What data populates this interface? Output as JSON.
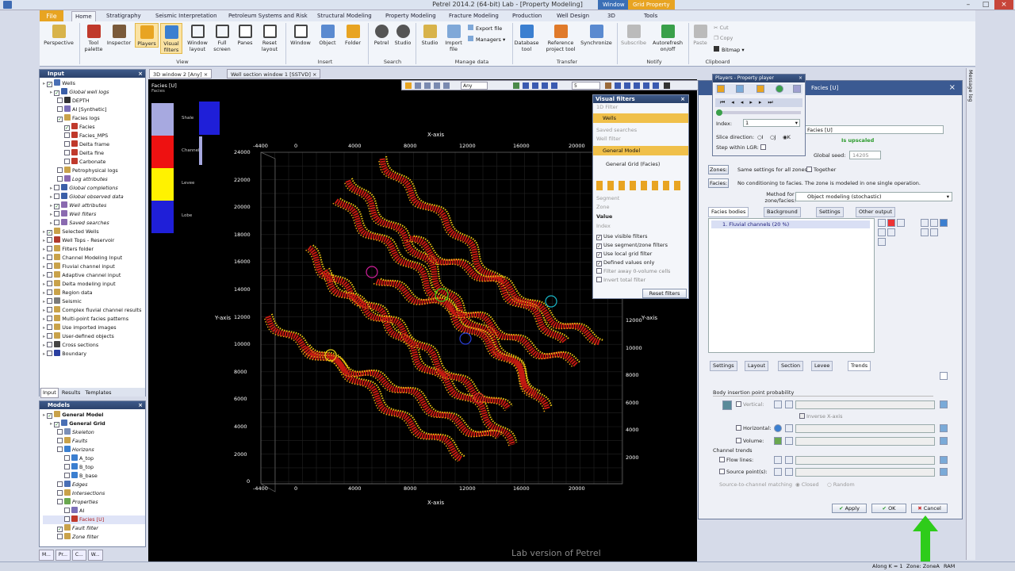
{
  "window": {
    "title": "Petrel 2014.2 (64-bit) Lab - [Property Modeling]",
    "context_tabs": [
      "Window",
      "Grid Property"
    ]
  },
  "ribbon": {
    "file_tab": "File",
    "tabs": [
      "Home",
      "Stratigraphy",
      "Seismic Interpretation",
      "Petroleum Systems and Risk",
      "Structural Modeling",
      "Property Modeling",
      "Fracture Modeling",
      "Production",
      "Well Design",
      "3D",
      "Tools"
    ],
    "buttons": {
      "perspective": "Perspective",
      "tool_palette": "Tool palette",
      "inspector": "Inspector",
      "players": "Players",
      "visual_filters": "Visual filters",
      "window_layout": "Window layout",
      "full_screen": "Full screen",
      "panes": "Panes",
      "reset_layout": "Reset layout",
      "window": "Window",
      "object": "Object",
      "folder": "Folder",
      "petrel": "Petrel",
      "studio": "Studio",
      "studio2": "Studio",
      "import_file": "Import file",
      "export_file": "Export file",
      "managers": "Managers",
      "database_tool": "Database tool",
      "reference_project_tool": "Reference project tool",
      "synchronize": "Synchronize",
      "subscribe": "Subscribe",
      "autorefresh": "Autorefresh on/off",
      "paste": "Paste",
      "cut": "Cut",
      "copy": "Copy",
      "bitmap": "Bitmap"
    },
    "groups": {
      "view": "View",
      "insert": "Insert",
      "search": "Search",
      "manage_data": "Manage data",
      "transfer": "Transfer",
      "notify": "Notify",
      "clipboard": "Clipboard"
    }
  },
  "input_panel": {
    "title": "Input",
    "items": [
      {
        "label": "Wells",
        "lvl": 0,
        "icon": "#4a6fb5",
        "cb": true
      },
      {
        "label": "Global well logs",
        "lvl": 1,
        "icon": "#3b5fa8",
        "cb": true,
        "it": true
      },
      {
        "label": "DEPTH",
        "lvl": 2,
        "icon": "#333",
        "cb": false
      },
      {
        "label": "AI [Synthetic]",
        "lvl": 2,
        "icon": "#7b6fb8",
        "cb": false
      },
      {
        "label": "Facies logs",
        "lvl": 2,
        "icon": "#c9a24a",
        "cb": true
      },
      {
        "label": "Facies",
        "lvl": 3,
        "icon": "#c0392b",
        "cb": true
      },
      {
        "label": "Facies_MPS",
        "lvl": 3,
        "icon": "#c0392b",
        "cb": false
      },
      {
        "label": "Delta frame",
        "lvl": 3,
        "icon": "#c0392b",
        "cb": false
      },
      {
        "label": "Delta fine",
        "lvl": 3,
        "icon": "#c0392b",
        "cb": false
      },
      {
        "label": "Carbonate",
        "lvl": 3,
        "icon": "#c0392b",
        "cb": false
      },
      {
        "label": "Petrophysical logs",
        "lvl": 2,
        "icon": "#c9a24a",
        "cb": false
      },
      {
        "label": "Log attributes",
        "lvl": 2,
        "icon": "#8a6ab0",
        "cb": false,
        "it": true
      },
      {
        "label": "Global completions",
        "lvl": 1,
        "icon": "#3b5fa8",
        "cb": false,
        "it": true
      },
      {
        "label": "Global observed data",
        "lvl": 1,
        "icon": "#3b5fa8",
        "cb": false,
        "it": true
      },
      {
        "label": "Well attributes",
        "lvl": 1,
        "icon": "#8a6ab0",
        "cb": true,
        "it": true
      },
      {
        "label": "Well filters",
        "lvl": 1,
        "icon": "#8a6ab0",
        "cb": false,
        "it": true
      },
      {
        "label": "Saved searches",
        "lvl": 1,
        "icon": "#8a6ab0",
        "cb": false,
        "it": true
      },
      {
        "label": "Selected Wells",
        "lvl": 0,
        "icon": "#c9a24a",
        "cb": true
      },
      {
        "label": "Well Tops - Reservoir",
        "lvl": 0,
        "icon": "#b03a2e",
        "cb": false
      },
      {
        "label": "Filters folder",
        "lvl": 0,
        "icon": "#c9a24a",
        "cb": false
      },
      {
        "label": "Channel Modeling Input",
        "lvl": 0,
        "icon": "#c9a24a",
        "cb": false
      },
      {
        "label": "Fluvial channel input",
        "lvl": 0,
        "icon": "#c9a24a",
        "cb": false
      },
      {
        "label": "Adaptive channel input",
        "lvl": 0,
        "icon": "#c9a24a",
        "cb": false
      },
      {
        "label": "Delta modeling input",
        "lvl": 0,
        "icon": "#c9a24a",
        "cb": false
      },
      {
        "label": "Region data",
        "lvl": 0,
        "icon": "#c9a24a",
        "cb": false
      },
      {
        "label": "Seismic",
        "lvl": 0,
        "icon": "#7a7a7a",
        "cb": false
      },
      {
        "label": "Complex fluvial channel results",
        "lvl": 0,
        "icon": "#c9a24a",
        "cb": false
      },
      {
        "label": "Multi-point facies patterns",
        "lvl": 0,
        "icon": "#c9a24a",
        "cb": false
      },
      {
        "label": "Use imported images",
        "lvl": 0,
        "icon": "#c9a24a",
        "cb": false
      },
      {
        "label": "User-defined objects",
        "lvl": 0,
        "icon": "#c9a24a",
        "cb": false
      },
      {
        "label": "Cross sections",
        "lvl": 0,
        "icon": "#444",
        "cb": false
      },
      {
        "label": "Boundary",
        "lvl": 0,
        "icon": "#2a3fa0",
        "cb": false
      }
    ],
    "tabs": [
      "Input",
      "Results",
      "Templates"
    ]
  },
  "models_panel": {
    "title": "Models",
    "items": [
      {
        "label": "General Model",
        "lvl": 0,
        "icon": "#c9a24a",
        "cb": true,
        "b": true
      },
      {
        "label": "General Grid",
        "lvl": 1,
        "icon": "#4a6fb5",
        "cb": true,
        "b": true
      },
      {
        "label": "Skeleton",
        "lvl": 2,
        "icon": "#7b8fb8",
        "cb": false,
        "it": true
      },
      {
        "label": "Faults",
        "lvl": 2,
        "icon": "#c9a24a",
        "cb": false,
        "it": true
      },
      {
        "label": "Horizons",
        "lvl": 2,
        "icon": "#3b7fd0",
        "cb": false,
        "it": true
      },
      {
        "label": "A_top",
        "lvl": 3,
        "icon": "#3b7fd0",
        "cb": false
      },
      {
        "label": "B_top",
        "lvl": 3,
        "icon": "#3b7fd0",
        "cb": false
      },
      {
        "label": "B_base",
        "lvl": 3,
        "icon": "#3b7fd0",
        "cb": false
      },
      {
        "label": "Edges",
        "lvl": 2,
        "icon": "#4a6fb5",
        "cb": false,
        "it": true
      },
      {
        "label": "Intersections",
        "lvl": 2,
        "icon": "#c9a24a",
        "cb": false,
        "it": true
      },
      {
        "label": "Properties",
        "lvl": 2,
        "icon": "#6aa84f",
        "cb": false,
        "it": true
      },
      {
        "label": "AI",
        "lvl": 3,
        "icon": "#7b6fb8",
        "cb": false
      },
      {
        "label": "Facies [U]",
        "lvl": 3,
        "icon": "#c0392b",
        "cb": false,
        "sel": true
      },
      {
        "label": "Fault filter",
        "lvl": 2,
        "icon": "#c9a24a",
        "cb": true,
        "it": true
      },
      {
        "label": "Zone filter",
        "lvl": 2,
        "icon": "#c9a24a",
        "cb": false,
        "it": true
      }
    ]
  },
  "document_tabs": [
    "3D window 2 [Any]",
    "Well section window 1 [SSTVD]"
  ],
  "viewport": {
    "legend_title": "Facies [U]",
    "legend_sub": "Facies",
    "legend_items": [
      {
        "name": "Shale",
        "color": "#a7a9e0"
      },
      {
        "name": "Channel",
        "color": "#ee1111"
      },
      {
        "name": "Levee",
        "color": "#fff200"
      },
      {
        "name": "Lobe",
        "color": "#1f1fd8"
      }
    ],
    "x_axis_label": "X-axis",
    "y_axis_label": "Y-axis",
    "x_ticks": [
      "-4400",
      "0",
      "4000",
      "8000",
      "12000",
      "16000",
      "20000"
    ],
    "y_ticks": [
      "24000",
      "22000",
      "20000",
      "18000",
      "16000",
      "14000",
      "12000",
      "10000",
      "8000",
      "6000",
      "4000",
      "2000",
      "0"
    ],
    "y_ticks_right": [
      "12000",
      "10000",
      "8000",
      "6000",
      "4000",
      "2000"
    ],
    "watermark": "Lab version of Petrel",
    "toolbar_any": "Any",
    "toolbar_num": "5"
  },
  "visual_filters": {
    "title": "Visual filters",
    "section_1d": "1D Filter",
    "wells": "Wells",
    "saved_searches": "Saved searches",
    "well_filter": "Well filter",
    "general_model": "General Model",
    "general_grid": "General Grid (Facies)",
    "segment": "Segment",
    "zone": "Zone",
    "value": "Value",
    "index": "Index",
    "checks": [
      {
        "label": "Use visible filters",
        "on": true
      },
      {
        "label": "Use segment/zone filters",
        "on": true
      },
      {
        "label": "Use local grid filter",
        "on": true
      },
      {
        "label": "Defined values only",
        "on": true
      },
      {
        "label": "Filter away 0-volume cells",
        "on": false
      },
      {
        "label": "Invert total filter",
        "on": false
      }
    ],
    "reset": "Reset filters"
  },
  "players": {
    "title": "Players - Property player",
    "index_label": "Index:",
    "index_value": "1",
    "slice_label": "Slice direction:",
    "slice_opts": [
      "I",
      "J",
      "K"
    ],
    "step_label": "Step within LGR:"
  },
  "property_dialog": {
    "title": "Facies [U]",
    "property_value": "Facies [U]",
    "upscaled": "Is upscaled",
    "global_seed_label": "Global seed:",
    "global_seed": "14205",
    "zones_btn": "Zones:",
    "zones_text": "Same settings for all zones",
    "together": "Together",
    "facies_btn": "Facies:",
    "facies_text": "No conditioning to facies. The zone is modeled in one single operation.",
    "method_label": "Method for zone/facies:",
    "method_value": "Object modeling (stochastic)",
    "tabs": [
      "Facies bodies",
      "Background",
      "Settings",
      "Other output"
    ],
    "body_item": "1. Fluvial channels (20 %)",
    "subtabs": [
      "Settings",
      "Layout",
      "Section",
      "Levee",
      "Trends"
    ],
    "body_prob": "Body insertion point probability",
    "vertical": "Vertical:",
    "inverse_x": "Inverse X-axis",
    "horizontal": "Horizontal:",
    "volume": "Volume:",
    "channel_trends": "Channel trends",
    "flow_lines": "Flow lines:",
    "source_points": "Source point(s):",
    "source_matching": "Source-to-channel matching",
    "closed": "Closed",
    "random": "Random",
    "apply": "Apply",
    "ok": "OK",
    "cancel": "Cancel"
  },
  "message_log": "Message log",
  "statusbar": {
    "along": "Along K = 1",
    "zone": "Zone: ZoneA",
    "ram": "RAM"
  },
  "taskbar": [
    "M...",
    "Pr...",
    "C...",
    "W..."
  ],
  "colors": {
    "accent": "#e8a422",
    "panel_header": "#2b426b",
    "arrow": "#2ecc1a"
  }
}
